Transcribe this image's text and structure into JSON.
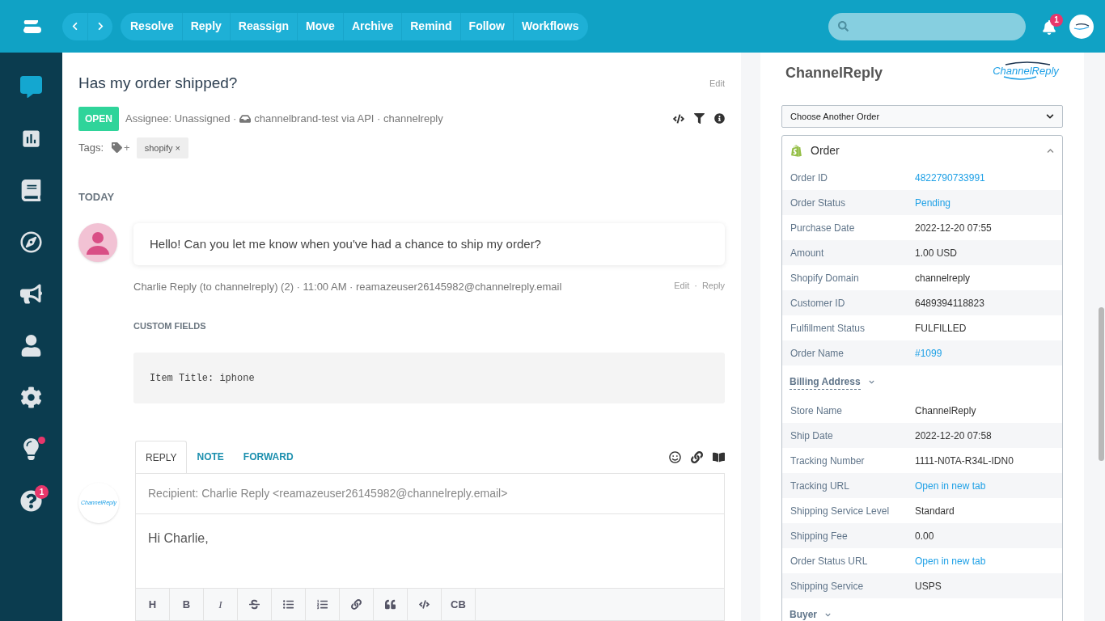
{
  "topbar": {
    "actions": [
      {
        "label": "Resolve"
      },
      {
        "label": "Reply"
      },
      {
        "label": "Reassign"
      },
      {
        "label": "Move"
      },
      {
        "label": "Archive"
      },
      {
        "label": "Remind"
      },
      {
        "label": "Follow"
      },
      {
        "label": "Workflows"
      }
    ],
    "notifications": "1"
  },
  "sidebar": [
    {
      "selected": true
    },
    {
      "selected": false
    },
    {
      "selected": false
    },
    {
      "selected": false
    },
    {
      "selected": false
    },
    {
      "selected": false
    },
    {
      "selected": false
    },
    {
      "selected": false,
      "dot": true
    },
    {
      "selected": false,
      "badge": "1"
    }
  ],
  "conversation": {
    "title": "Has my order shipped?",
    "edit": "Edit",
    "status": "OPEN",
    "meta_assignee": "Assignee: Unassigned ·",
    "meta_channel": "channelbrand-test via API · channelreply",
    "tags_label": "Tags:",
    "tag_add": "+",
    "tags": [
      "shopify ×"
    ]
  },
  "day": "TODAY",
  "message": {
    "text": "Hello! Can you let me know when you've had a chance to ship my order?",
    "meta": "Charlie Reply (to channelreply) (2) · 11:00 AM · reamazeuser26145982@channelreply.email",
    "edit": "Edit",
    "sep": "·",
    "reply": "Reply",
    "custom_fields_title": "CUSTOM FIELDS",
    "custom_fields": "Item Title: iphone"
  },
  "composer": {
    "tabs": [
      {
        "label": "REPLY",
        "selected": true
      },
      {
        "label": "NOTE",
        "selected": false
      },
      {
        "label": "FORWARD",
        "selected": false
      }
    ],
    "avatar_text": "ChannelReply",
    "recipient": "Recipient: Charlie Reply <reamazeuser26145982@channelreply.email>",
    "body": "Hi Charlie,",
    "toolbar_text": [
      "H",
      "B",
      "I",
      "CB"
    ]
  },
  "panel": {
    "title": "ChannelReply",
    "logo_text": "ChannelReply",
    "select": "Choose Another Order",
    "order": {
      "title": "Order",
      "expanded": true,
      "rows": [
        {
          "label": "Order ID",
          "value": "4822790733991",
          "link": true
        },
        {
          "label": "Order Status",
          "value": "Pending",
          "link": true
        },
        {
          "label": "Purchase Date",
          "value": "2022-12-20 07:55",
          "link": false
        },
        {
          "label": "Amount",
          "value": "1.00 USD",
          "link": false
        },
        {
          "label": "Shopify Domain",
          "value": "channelreply",
          "link": false
        },
        {
          "label": "Customer ID",
          "value": "6489394118823",
          "link": false
        },
        {
          "label": "Fulfillment Status",
          "value": "FULFILLED",
          "link": false
        },
        {
          "label": "Order Name",
          "value": "#1099",
          "link": true
        }
      ],
      "sections": [
        {
          "title": "Billing Address",
          "rows": [
            {
              "label": "Store Name",
              "value": "ChannelReply",
              "link": false
            },
            {
              "label": "Ship Date",
              "value": "2022-12-20 07:58",
              "link": false
            },
            {
              "label": "Tracking Number",
              "value": "1111-N0TA-R34L-IDN0",
              "link": false
            },
            {
              "label": "Tracking URL",
              "value": "Open in new tab",
              "link": true
            },
            {
              "label": "Shipping Service Level",
              "value": "Standard",
              "link": false
            },
            {
              "label": "Shipping Fee",
              "value": "0.00",
              "link": false
            },
            {
              "label": "Order Status URL",
              "value": "Open in new tab",
              "link": true
            },
            {
              "label": "Shipping Service",
              "value": "USPS",
              "link": false
            }
          ]
        },
        {
          "title": "Buyer"
        }
      ]
    }
  }
}
